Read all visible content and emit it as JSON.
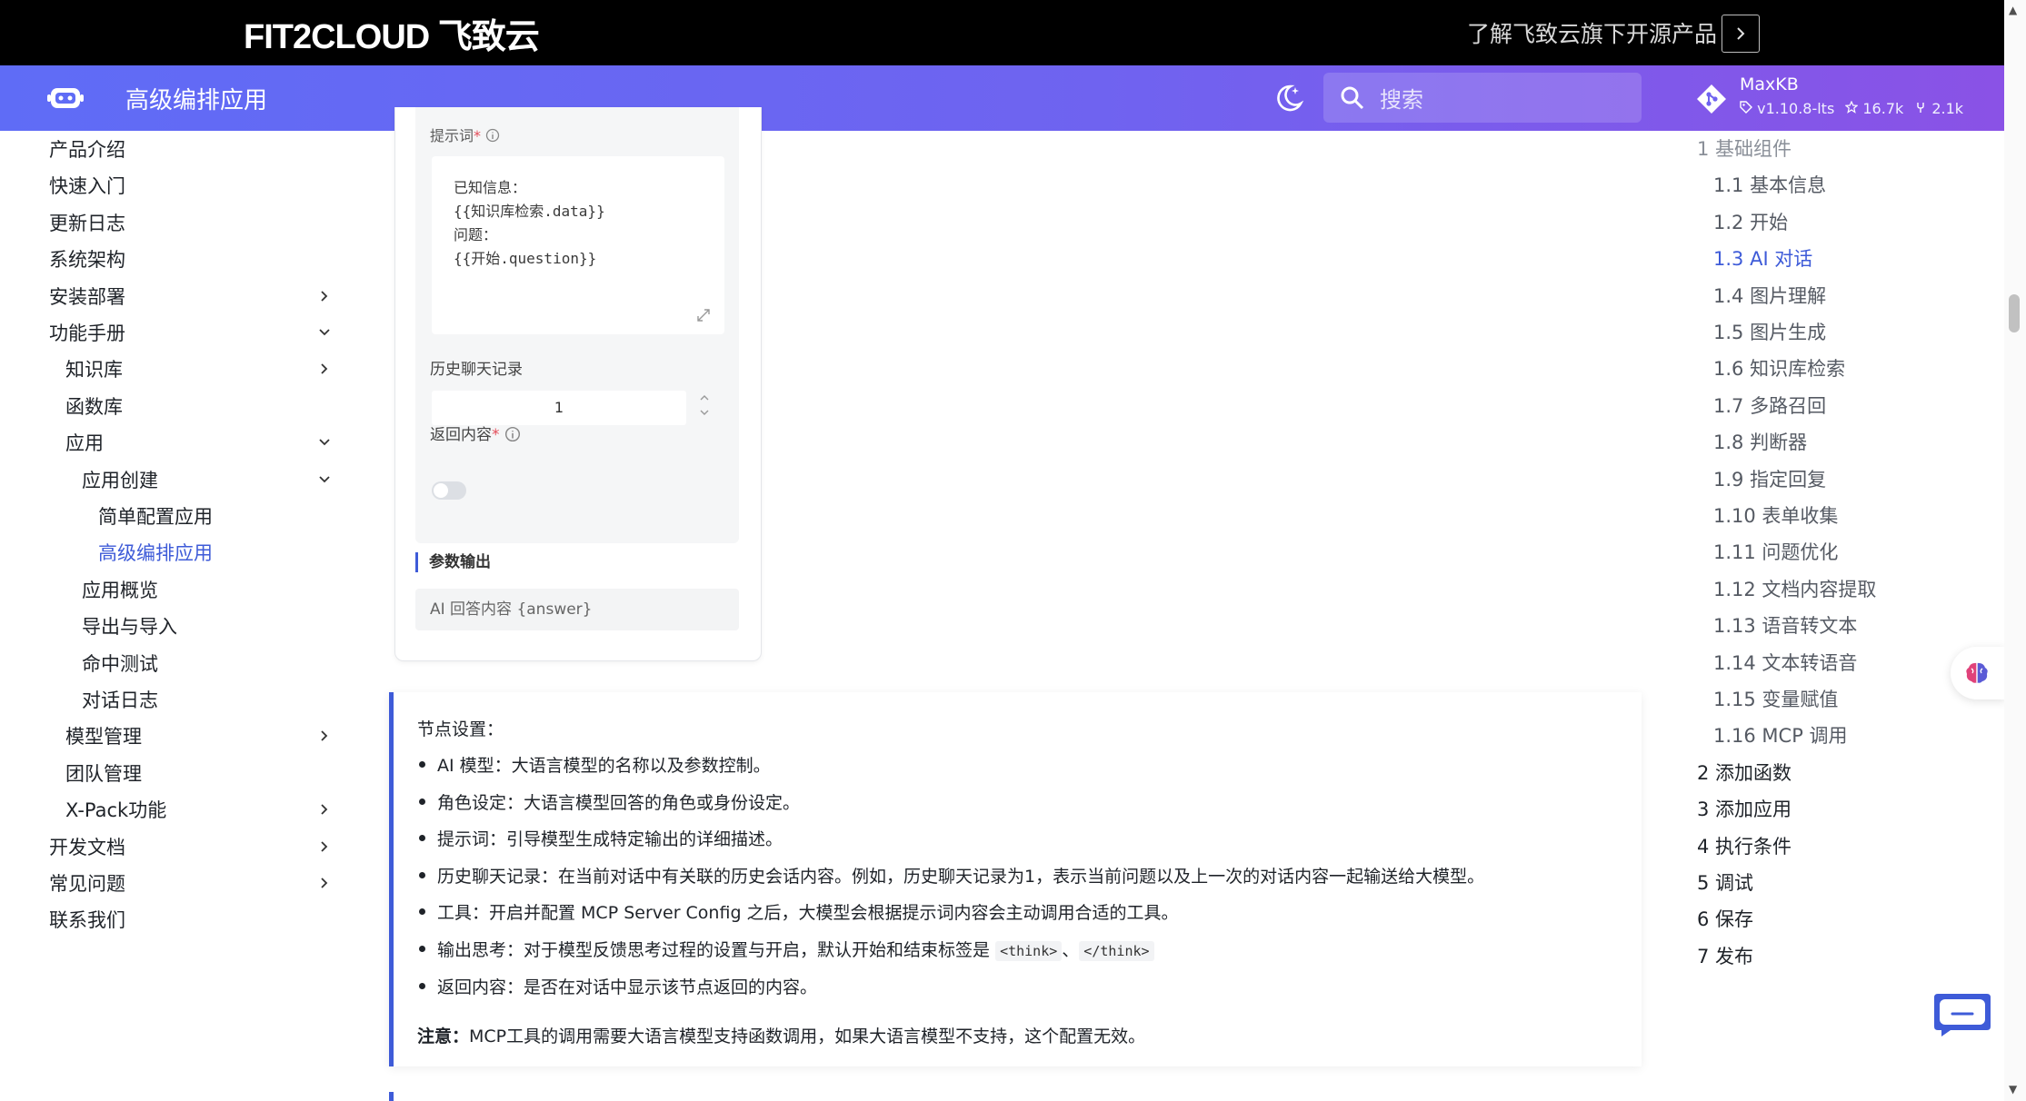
{
  "promo": {
    "brand": "FIT2CLOUD 飞致云",
    "text": "了解飞致云旗下开源产品"
  },
  "nav": {
    "title": "高级编排应用",
    "search_placeholder": "搜索",
    "repo_name": "MaxKB",
    "version": "v1.10.8-lts",
    "stars": "16.7k",
    "forks": "2.1k"
  },
  "sidebar": [
    {
      "label": "产品介绍"
    },
    {
      "label": "快速入门"
    },
    {
      "label": "更新日志"
    },
    {
      "label": "系统架构"
    },
    {
      "label": "安装部署",
      "chevron": "right"
    },
    {
      "label": "功能手册",
      "chevron": "down"
    },
    {
      "label": "知识库",
      "chevron": "right"
    },
    {
      "label": "函数库"
    },
    {
      "label": "应用",
      "chevron": "down"
    },
    {
      "label": "应用创建",
      "chevron": "down"
    },
    {
      "label": "简单配置应用"
    },
    {
      "label": "高级编排应用",
      "active": true
    },
    {
      "label": "应用概览"
    },
    {
      "label": "导出与导入"
    },
    {
      "label": "命中测试"
    },
    {
      "label": "对话日志"
    },
    {
      "label": "模型管理",
      "chevron": "right"
    },
    {
      "label": "团队管理"
    },
    {
      "label": "X-Pack功能",
      "chevron": "right"
    },
    {
      "label": "开发文档",
      "chevron": "right"
    },
    {
      "label": "常见问题",
      "chevron": "right"
    },
    {
      "label": "联系我们"
    }
  ],
  "screenshot": {
    "prompt_label": "提示词",
    "prompt_text": "已知信息：\n{{知识库检索.data}}\n问题：\n{{开始.question}}",
    "history_label": "历史聊天记录",
    "history_value": "1",
    "return_label": "返回内容",
    "output_title": "参数输出",
    "output_value": "AI 回答内容 {answer}"
  },
  "tip": {
    "heading": "节点设置：",
    "items": [
      "AI 模型：大语言模型的名称以及参数控制。",
      "角色设定：大语言模型回答的角色或身份设定。",
      "提示词：引导模型生成特定输出的详细描述。",
      "历史聊天记录：在当前对话中有关联的历史会话内容。例如，历史聊天记录为1，表示当前问题以及上一次的对话内容一起输送给大模型。",
      "工具：开启并配置 MCP Server Config 之后，大模型会根据提示词内容会主动调用合适的工具。"
    ],
    "think_item_prefix": "输出思考：对于模型反馈思考过程的设置与开启，默认开始和结束标签是",
    "think_open": "<think>",
    "think_sep": "、",
    "think_close": "</think>",
    "last_item": "返回内容：是否在对话中显示该节点返回的内容。",
    "note_label": "注意：",
    "note_text": "MCP工具的调用需要大语言模型支持函数调用，如果大语言模型不支持，这个配置无效。"
  },
  "toc": [
    {
      "label": "1 基础组件",
      "level": 1,
      "cut": true
    },
    {
      "label": "1.1 基本信息",
      "level": 2
    },
    {
      "label": "1.2 开始",
      "level": 2
    },
    {
      "label": "1.3 AI 对话",
      "level": 2,
      "active": true
    },
    {
      "label": "1.4 图片理解",
      "level": 2
    },
    {
      "label": "1.5 图片生成",
      "level": 2
    },
    {
      "label": "1.6 知识库检索",
      "level": 2
    },
    {
      "label": "1.7 多路召回",
      "level": 2
    },
    {
      "label": "1.8 判断器",
      "level": 2
    },
    {
      "label": "1.9 指定回复",
      "level": 2
    },
    {
      "label": "1.10 表单收集",
      "level": 2
    },
    {
      "label": "1.11 问题优化",
      "level": 2
    },
    {
      "label": "1.12 文档内容提取",
      "level": 2
    },
    {
      "label": "1.13 语音转文本",
      "level": 2
    },
    {
      "label": "1.14 文本转语音",
      "level": 2
    },
    {
      "label": "1.15 变量赋值",
      "level": 2
    },
    {
      "label": "1.16 MCP 调用",
      "level": 2
    },
    {
      "label": "2 添加函数",
      "level": 1
    },
    {
      "label": "3 添加应用",
      "level": 1
    },
    {
      "label": "4 执行条件",
      "level": 1
    },
    {
      "label": "5 调试",
      "level": 1
    },
    {
      "label": "6 保存",
      "level": 1
    },
    {
      "label": "7 发布",
      "level": 1
    }
  ],
  "colors": {
    "accent": "#3e5bd8",
    "nav_gradient_start": "#5f6cf6",
    "nav_gradient_end": "#8a52e6"
  }
}
